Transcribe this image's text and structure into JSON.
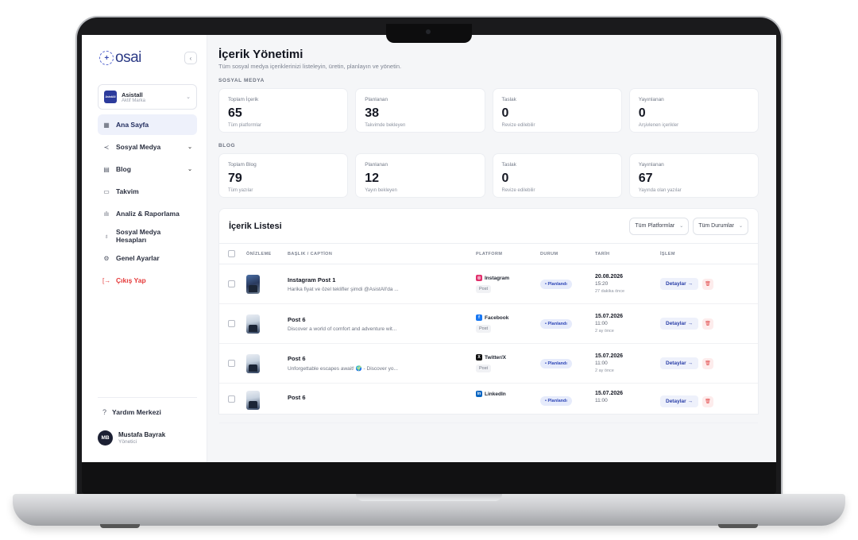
{
  "sidebar": {
    "logo_text": "osai",
    "collapse_icon": "‹",
    "brand": {
      "logo": "AsistAll",
      "name": "Asistall",
      "sub": "Aktif Marka"
    },
    "items": [
      {
        "label": "Ana Sayfa",
        "icon": "▦"
      },
      {
        "label": "Sosyal Medya",
        "icon": "≺"
      },
      {
        "label": "Blog",
        "icon": "▤"
      },
      {
        "label": "Takvim",
        "icon": "▭"
      },
      {
        "label": "Analiz & Raporlama",
        "icon": "ılı"
      },
      {
        "label": "Sosyal Medya Hesapları",
        "icon": "♁"
      },
      {
        "label": "Genel Ayarlar",
        "icon": "⚙"
      },
      {
        "label": "Çıkış Yap",
        "icon": "[→"
      }
    ],
    "help_label": "Yardım Merkezi",
    "help_icon": "?",
    "user": {
      "initials": "MB",
      "name": "Mustafa Bayrak",
      "role": "Yönetici"
    }
  },
  "header": {
    "title": "İçerik Yönetimi",
    "subtitle": "Tüm sosyal medya içeriklerinizi listeleyin, üretin, planlayın ve yönetin."
  },
  "social": {
    "label": "SOSYAL MEDYA",
    "cards": [
      {
        "label": "Toplam İçerik",
        "value": "65",
        "sub": "Tüm platformlar"
      },
      {
        "label": "Planlanan",
        "value": "38",
        "sub": "Takvimde bekleyen"
      },
      {
        "label": "Taslak",
        "value": "0",
        "sub": "Revize edilebilir"
      },
      {
        "label": "Yayınlanan",
        "value": "0",
        "sub": "Arşivlenen içerikler"
      }
    ]
  },
  "blog": {
    "label": "BLOG",
    "cards": [
      {
        "label": "Toplam Blog",
        "value": "79",
        "sub": "Tüm yazılar"
      },
      {
        "label": "Planlanan",
        "value": "12",
        "sub": "Yayın bekleyen"
      },
      {
        "label": "Taslak",
        "value": "0",
        "sub": "Revize edilebilir"
      },
      {
        "label": "Yayınlanan",
        "value": "67",
        "sub": "Yayında olan yazılar"
      }
    ]
  },
  "list": {
    "title": "İçerik Listesi",
    "filter_platform": "Tüm Platformlar",
    "filter_status": "Tüm Durumlar",
    "columns": [
      "ÖNİZLEME",
      "BAŞLIK / CAPTİON",
      "PLATFORM",
      "DURUM",
      "TARİH",
      "İŞLEM"
    ],
    "detail_label": "Detaylar →",
    "delete_icon": "🗑",
    "rows": [
      {
        "title": "Instagram Post 1",
        "desc": "Harika fiyat ve özel teklifler şimdi @AsistAll'da ...",
        "platform": "Instagram",
        "platform_color": "#e1306c",
        "platform_icon": "◎",
        "type": "Post",
        "status": "• Planlandı",
        "date": "20.08.2026",
        "time": "15:20",
        "rel": "27 dakika önce"
      },
      {
        "title": "Post 6",
        "desc": "Discover a world of comfort and adventure wit...",
        "platform": "Facebook",
        "platform_color": "#1877f2",
        "platform_icon": "f",
        "type": "Post",
        "status": "• Planlandı",
        "date": "15.07.2026",
        "time": "11:00",
        "rel": "2 ay önce"
      },
      {
        "title": "Post 6",
        "desc": "Unforgettable escapes await! 🌍 - Discover yo...",
        "platform": "Twitter/X",
        "platform_color": "#111111",
        "platform_icon": "X",
        "type": "Post",
        "status": "• Planlandı",
        "date": "15.07.2026",
        "time": "11:00",
        "rel": "2 ay önce"
      },
      {
        "title": "Post 6",
        "desc": "",
        "platform": "LinkedIn",
        "platform_color": "#0a66c2",
        "platform_icon": "in",
        "type": "",
        "status": "• Planlandı",
        "date": "15.07.2026",
        "time": "11:00",
        "rel": ""
      }
    ]
  }
}
